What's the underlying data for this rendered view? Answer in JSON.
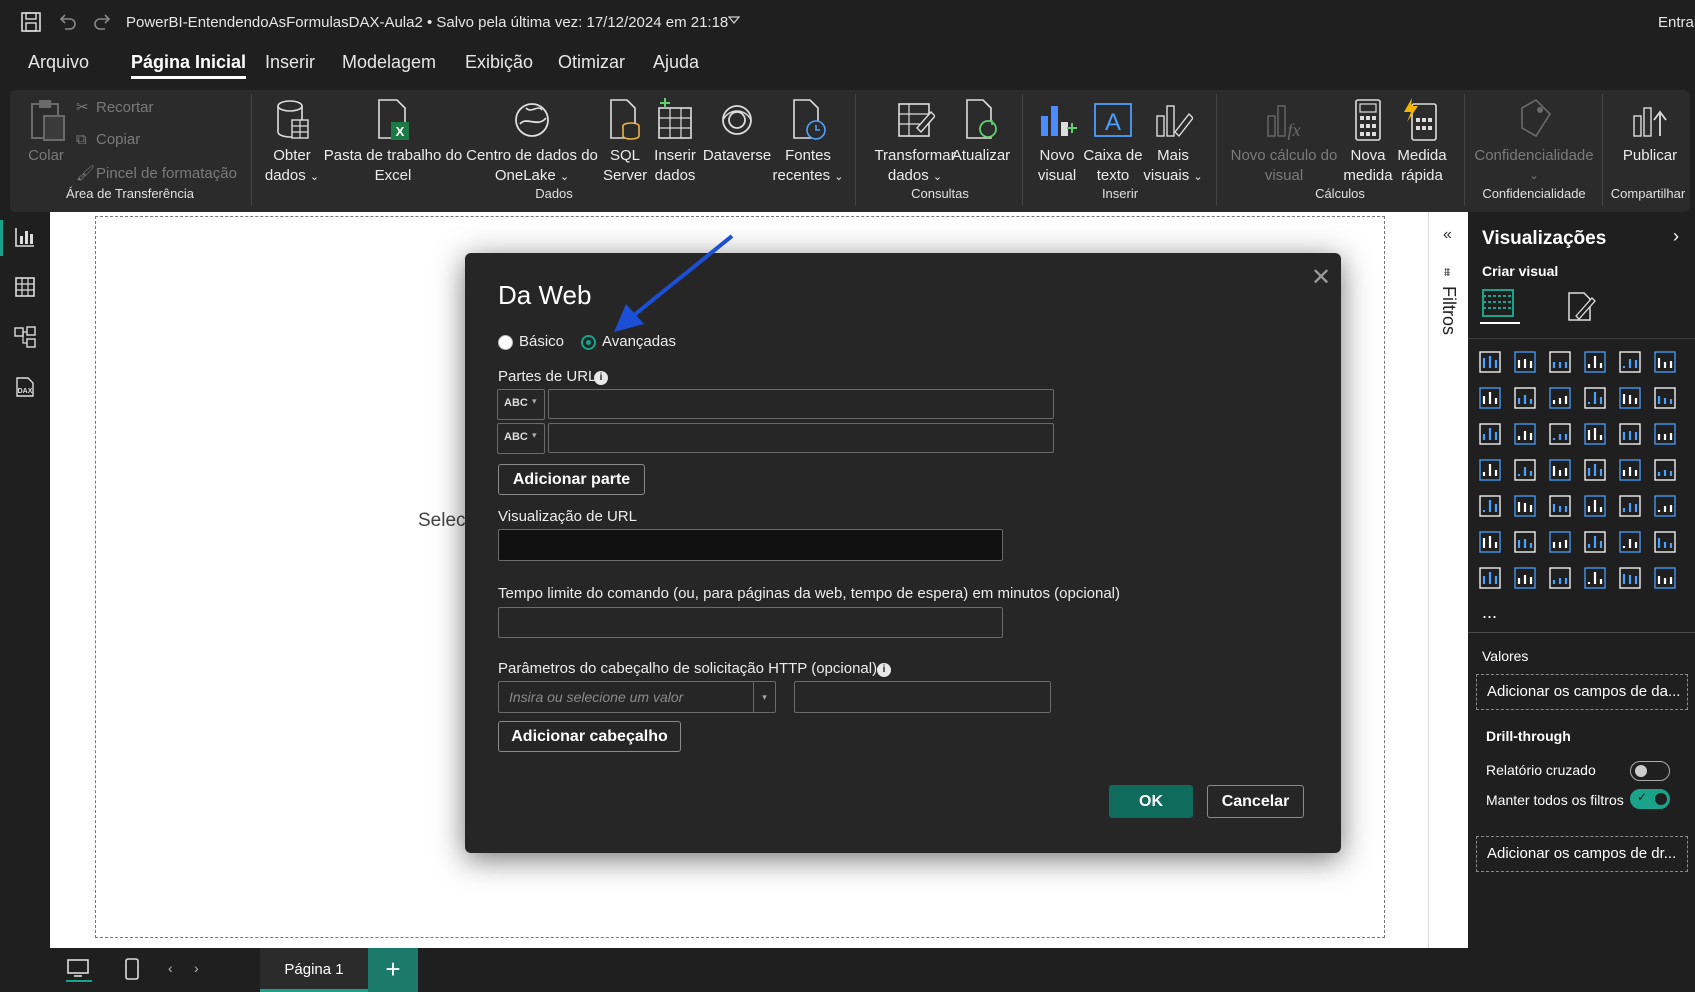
{
  "titlebar": {
    "document_title": "PowerBI-EntendendoAsFormulasDAX-Aula2",
    "save_status": "• Salvo pela última vez: 17/12/2024 em 21:18",
    "sign_in": "Entrar"
  },
  "menu": {
    "tabs": [
      "Arquivo",
      "Página Inicial",
      "Inserir",
      "Modelagem",
      "Exibição",
      "Otimizar",
      "Ajuda"
    ],
    "active_tab": "Página Inicial"
  },
  "ribbon": {
    "clipboard": {
      "paste": "Colar",
      "cut": "Recortar",
      "copy": "Copiar",
      "format_painter": "Pincel de formatação",
      "group_label": "Área de Transferência"
    },
    "data": {
      "get_data_1": "Obter",
      "get_data_2": "dados",
      "excel_1": "Pasta de trabalho do",
      "excel_2": "Excel",
      "onelake_1": "Centro de dados do",
      "onelake_2": "OneLake",
      "sql_1": "SQL",
      "sql_2": "Server",
      "insert_data_1": "Inserir",
      "insert_data_2": "dados",
      "dataverse": "Dataverse",
      "recent_1": "Fontes",
      "recent_2": "recentes",
      "group_label": "Dados"
    },
    "queries": {
      "transform_1": "Transformar",
      "transform_2": "dados",
      "refresh": "Atualizar",
      "group_label": "Consultas"
    },
    "insert": {
      "new_visual_1": "Novo",
      "new_visual_2": "visual",
      "text_box_1": "Caixa de",
      "text_box_2": "texto",
      "more_visuals_1": "Mais",
      "more_visuals_2": "visuais",
      "group_label": "Inserir"
    },
    "calculations": {
      "visual_calc_1": "Novo cálculo do",
      "visual_calc_2": "visual",
      "new_measure_1": "Nova",
      "new_measure_2": "medida",
      "quick_measure_1": "Medida",
      "quick_measure_2": "rápida",
      "group_label": "Cálculos"
    },
    "sensitivity": {
      "label": "Confidencialidade",
      "group_label": "Confidencialidade"
    },
    "share": {
      "publish": "Publicar",
      "group_label": "Compartilhar"
    }
  },
  "canvas": {
    "partial_text": "Selec"
  },
  "filters_pane": {
    "label": "Filtros"
  },
  "visualizations_pane": {
    "title": "Visualizações",
    "build_visual": "Criar visual",
    "values_label": "Valores",
    "values_placeholder": "Adicionar os campos de da...",
    "drillthrough_label": "Drill-through",
    "cross_report": "Relatório cruzado",
    "cross_report_on": false,
    "keep_filters": "Manter todos os filtros",
    "keep_filters_on": true,
    "drill_placeholder": "Adicionar os campos de dr...",
    "more": "..."
  },
  "bottombar": {
    "page_tab": "Página 1",
    "add_page": "+"
  },
  "dialog": {
    "title": "Da Web",
    "radio_basic": "Básico",
    "radio_advanced": "Avançadas",
    "selected_mode": "Avançadas",
    "url_parts_label": "Partes de URL",
    "part_type_1": "ABC",
    "part_type_2": "ABC",
    "part_value_1": "",
    "part_value_2": "",
    "add_part": "Adicionar parte",
    "url_preview_label": "Visualização de URL",
    "url_preview_value": "",
    "timeout_label": "Tempo limite do comando (ou, para páginas da web, tempo de espera) em minutos (opcional)",
    "timeout_value": "",
    "headers_label": "Parâmetros do cabeçalho de solicitação HTTP (opcional)",
    "header_name_placeholder": "Insira ou selecione um valor",
    "header_value": "",
    "add_header": "Adicionar cabeçalho",
    "ok": "OK",
    "cancel": "Cancelar"
  },
  "colors": {
    "accent": "#0f6b5c",
    "annotation_arrow": "#1a4fd6",
    "background": "#1f1f1f",
    "ribbon": "#2b2b2b",
    "dialog": "#262626"
  }
}
